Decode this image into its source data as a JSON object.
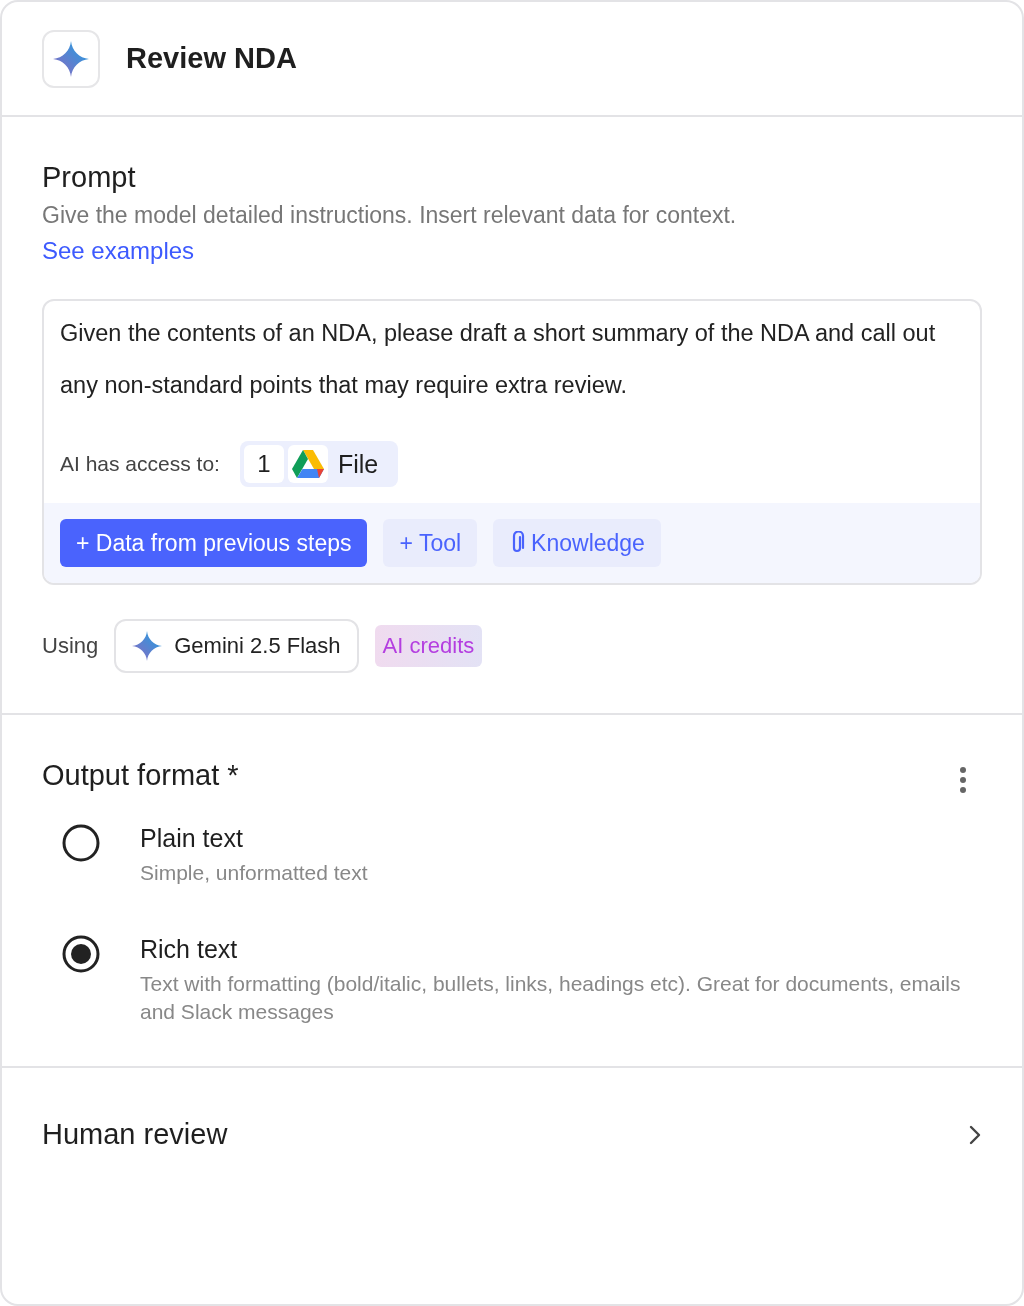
{
  "header": {
    "title": "Review NDA"
  },
  "prompt": {
    "title": "Prompt",
    "description": "Give the model detailed instructions. Insert relevant data for context.",
    "link": "See examples",
    "value": "Given the contents of an NDA, please draft a short summary of the NDA and call out any non-standard points that may require extra review.",
    "access_label": "AI has access to:",
    "access_count": "1",
    "access_item": "File",
    "actions": [
      {
        "kind": "primary",
        "label": "+ Data from previous steps"
      },
      {
        "kind": "secondary",
        "label": "+ Tool"
      },
      {
        "kind": "attach",
        "label": "Knowledge"
      }
    ]
  },
  "model": {
    "label": "Using",
    "name": "Gemini 2.5 Flash",
    "badge": "AI credits"
  },
  "output_format": {
    "title": "Output format *",
    "options": [
      {
        "label": "Plain text",
        "description": "Simple, unformatted text",
        "selected": false
      },
      {
        "label": "Rich text",
        "description": "Text with formatting (bold/italic, bullets, links, headings etc). Great for documents, emails and Slack messages",
        "selected": true
      }
    ]
  },
  "human_review": {
    "title": "Human review"
  }
}
